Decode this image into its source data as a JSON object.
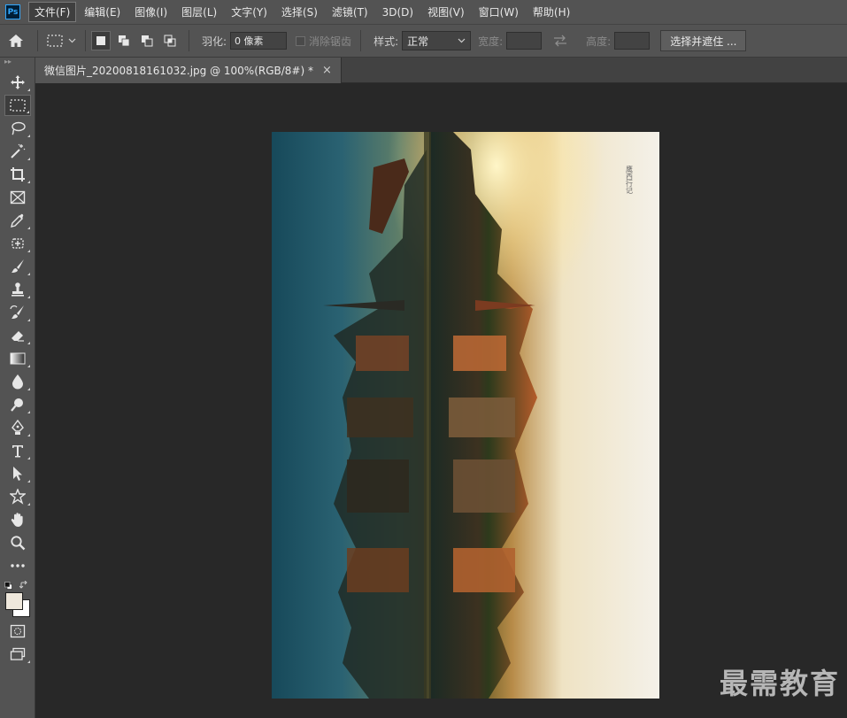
{
  "app": {
    "logo_text": "Ps"
  },
  "menu": {
    "items": [
      {
        "label": "文件(F)"
      },
      {
        "label": "编辑(E)"
      },
      {
        "label": "图像(I)"
      },
      {
        "label": "图层(L)"
      },
      {
        "label": "文字(Y)"
      },
      {
        "label": "选择(S)"
      },
      {
        "label": "滤镜(T)"
      },
      {
        "label": "3D(D)"
      },
      {
        "label": "视图(V)"
      },
      {
        "label": "窗口(W)"
      },
      {
        "label": "帮助(H)"
      }
    ]
  },
  "options": {
    "feather_label": "羽化:",
    "feather_value": "0 像素",
    "antialias_label": "消除锯齿",
    "style_label": "样式:",
    "style_value": "正常",
    "width_label": "宽度:",
    "height_label": "高度:",
    "select_mask_label": "选择并遮住 ..."
  },
  "document": {
    "tab_title": "微信图片_20200818161032.jpg @ 100%(RGB/8#) *",
    "close_glyph": "×"
  },
  "image": {
    "vertical_text": "鹰西行记"
  },
  "colors": {
    "foreground": "#efe8dc",
    "background": "#ffffff",
    "accent": "#31a8ff"
  },
  "watermark": {
    "text": "最需教育"
  }
}
